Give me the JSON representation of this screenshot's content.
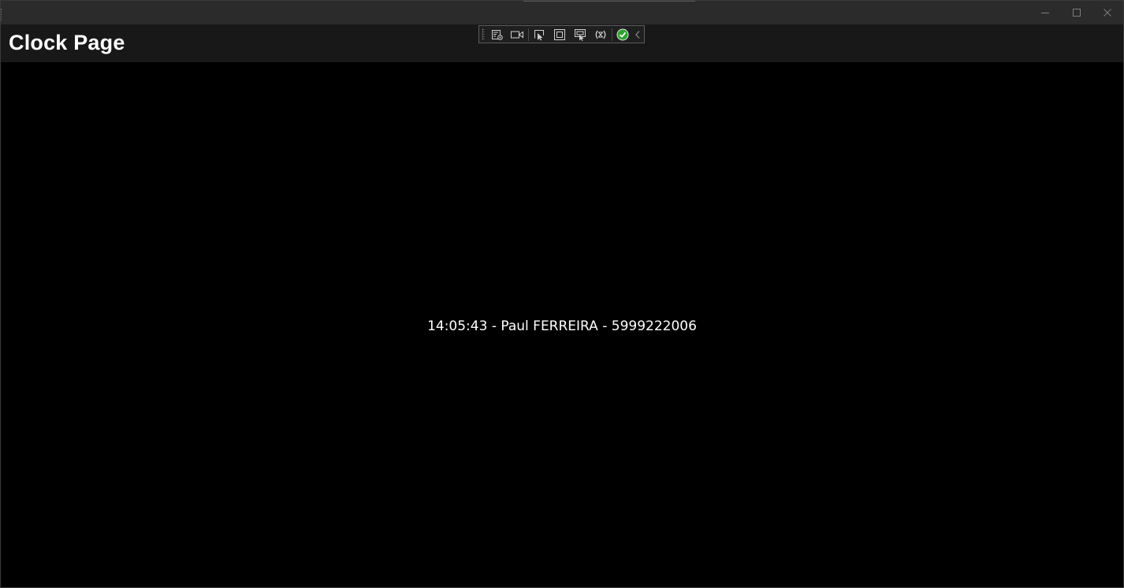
{
  "window": {
    "title": "",
    "controls": {
      "minimize_icon": "minimize-icon",
      "maximize_icon": "maximize-icon",
      "close_icon": "close-icon"
    }
  },
  "header": {
    "title": "Clock Page"
  },
  "debug_toolbar": {
    "tools": [
      "live-visual-tree-icon",
      "record-icon",
      "select-element-icon",
      "display-layout-adorners-icon",
      "track-focus-icon",
      "hot-reload-icon",
      "xaml-binding-check-icon",
      "collapse-toolbar-icon"
    ]
  },
  "main": {
    "clock_text": "14:05:43 - Paul FERREIRA - 5999222006"
  },
  "colors": {
    "titlebar_bg": "#2b2b2b",
    "header_bg": "#181818",
    "content_bg": "#000000",
    "text": "#ffffff",
    "check_green": "#2aa52a"
  }
}
